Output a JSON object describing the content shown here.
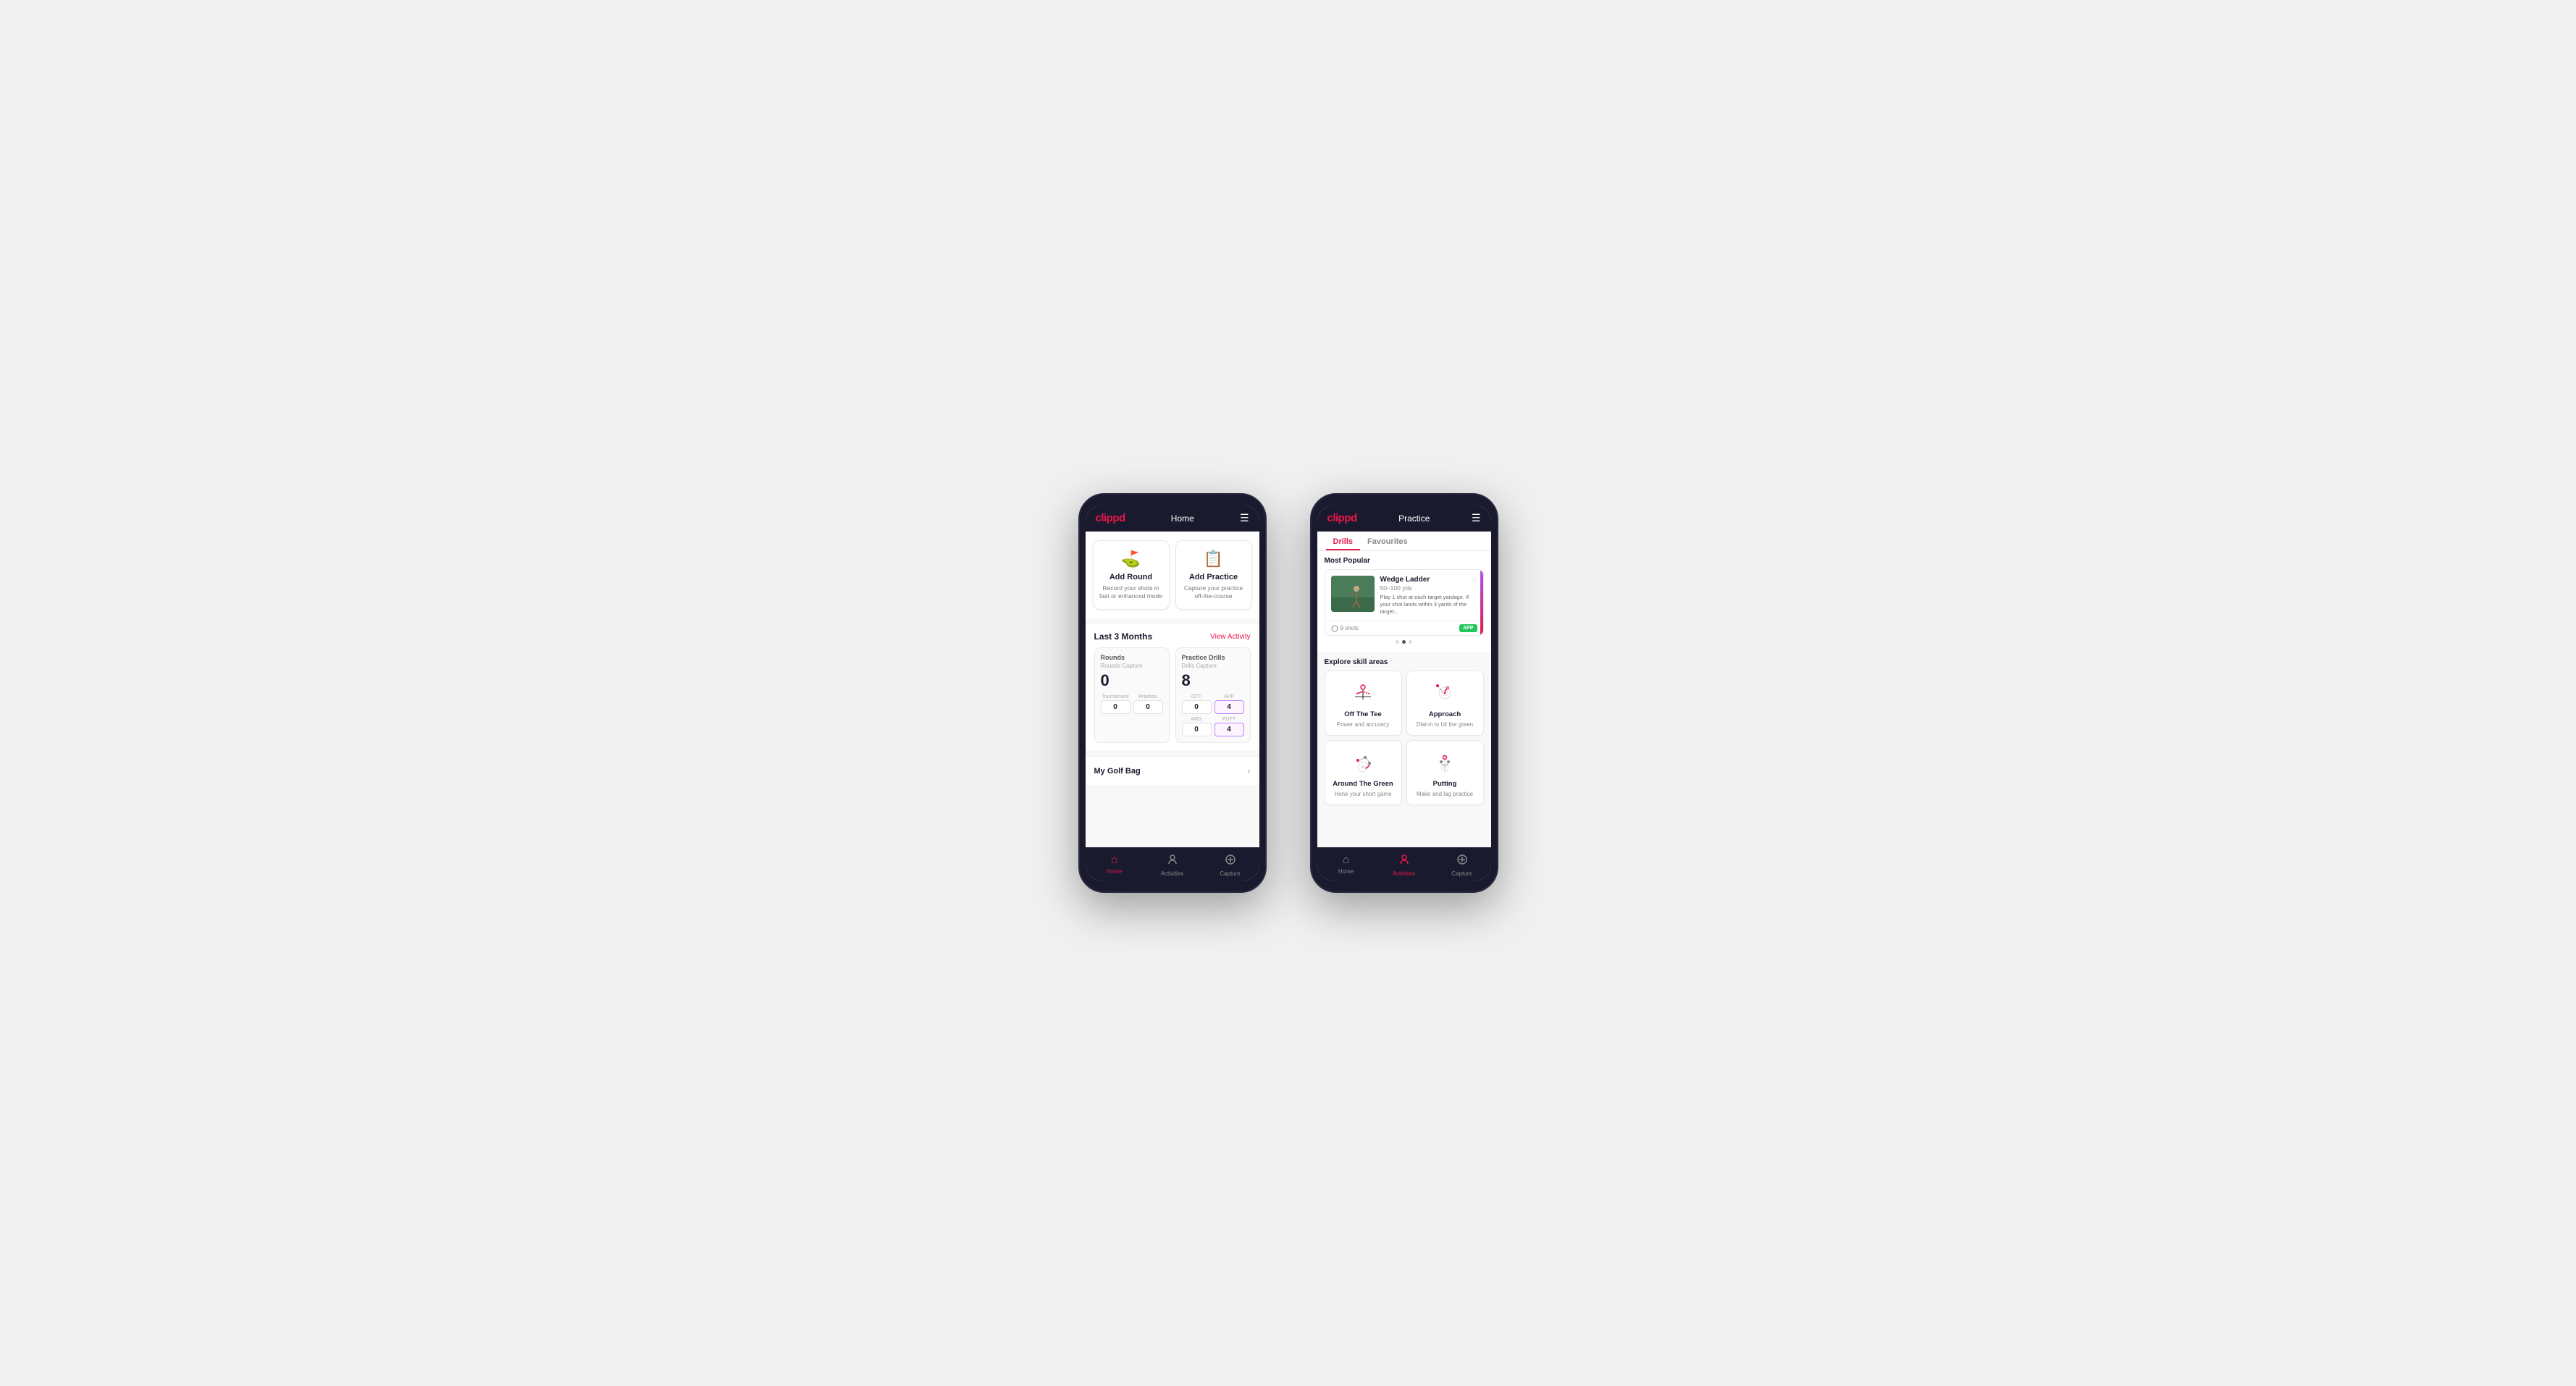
{
  "phone1": {
    "logo": "clippd",
    "header_title": "Home",
    "action_cards": [
      {
        "id": "add-round",
        "icon": "⛳",
        "title": "Add Round",
        "desc": "Record your shots in fast or enhanced mode"
      },
      {
        "id": "add-practice",
        "icon": "📋",
        "title": "Add Practice",
        "desc": "Capture your practice off-the-course"
      }
    ],
    "stats_section": {
      "title": "Last 3 Months",
      "view_activity": "View Activity",
      "rounds": {
        "label": "Rounds",
        "capture_label": "Rounds Capture",
        "value": "0",
        "sub": [
          {
            "label": "Tournament",
            "value": "0"
          },
          {
            "label": "Practice",
            "value": "0"
          }
        ]
      },
      "drills": {
        "label": "Practice Drills",
        "capture_label": "Drills Capture",
        "value": "8",
        "sub": [
          {
            "label": "OTT",
            "value": "0"
          },
          {
            "label": "APP",
            "value": "4",
            "highlight": true
          },
          {
            "label": "ARG",
            "value": "0"
          },
          {
            "label": "PUTT",
            "value": "4",
            "highlight": true
          }
        ]
      }
    },
    "golf_bag": "My Golf Bag",
    "nav": [
      {
        "label": "Home",
        "icon": "⌂",
        "active": true
      },
      {
        "label": "Activities",
        "icon": "⚡",
        "active": false
      },
      {
        "label": "Capture",
        "icon": "⊕",
        "active": false
      }
    ]
  },
  "phone2": {
    "logo": "clippd",
    "header_title": "Practice",
    "tabs": [
      {
        "label": "Drills",
        "active": true
      },
      {
        "label": "Favourites",
        "active": false
      }
    ],
    "most_popular_label": "Most Popular",
    "drill_card": {
      "name": "Wedge Ladder",
      "range": "50–100 yds",
      "desc": "Play 1 shot at each target yardage. If your shot lands within 3 yards of the target...",
      "shots": "9 shots",
      "badge": "APP",
      "dots": [
        false,
        true,
        false
      ]
    },
    "explore_label": "Explore skill areas",
    "skills": [
      {
        "name": "Off The Tee",
        "desc": "Power and accuracy",
        "icon_type": "tee"
      },
      {
        "name": "Approach",
        "desc": "Dial-in to hit the green",
        "icon_type": "approach"
      },
      {
        "name": "Around The Green",
        "desc": "Hone your short game",
        "icon_type": "around"
      },
      {
        "name": "Putting",
        "desc": "Make and lag practice",
        "icon_type": "putting"
      }
    ],
    "nav": [
      {
        "label": "Home",
        "icon": "⌂",
        "active": false
      },
      {
        "label": "Activities",
        "icon": "⚡",
        "active": true
      },
      {
        "label": "Capture",
        "icon": "⊕",
        "active": false
      }
    ]
  }
}
